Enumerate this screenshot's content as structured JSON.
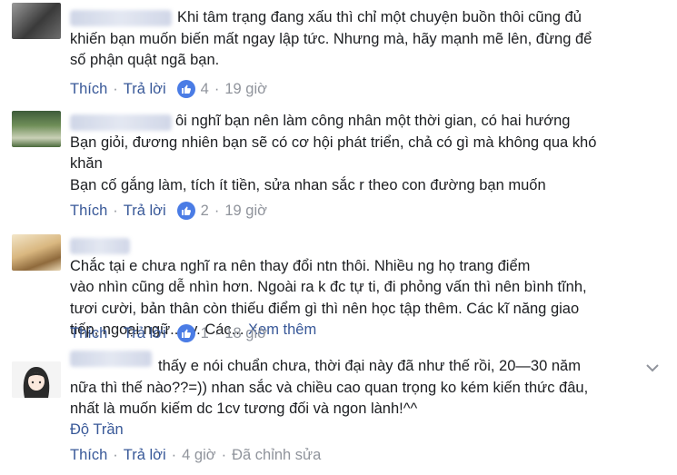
{
  "comments": [
    {
      "text": "Khi tâm trạng đang xấu thì chỉ một chuyện buồn thôi cũng đủ\nkhiến bạn muốn biến mất ngay lập tức. Nhưng mà, hãy mạnh mẽ lên, đừng để\nsố phận quật ngã bạn.",
      "like_label": "Thích",
      "reply_label": "Trả lời",
      "reactions": "4",
      "time": "19 giờ"
    },
    {
      "text": "ôi nghĩ bạn nên làm công nhân một thời gian, có hai hướng\nBạn giỏi, đương nhiên bạn sẽ có cơ hội phát triển, chả có gì mà không qua khó\nkhăn\nBạn cố gắng làm, tích ít tiền, sửa nhan sắc r theo con đường bạn muốn",
      "like_label": "Thích",
      "reply_label": "Trả lời",
      "reactions": "2",
      "time": "19 giờ"
    },
    {
      "text": "Chắc tại e chưa nghĩ ra nên thay đổi ntn thôi. Nhiều ng họ trang điểm\nvào nhìn cũng dễ nhìn hơn. Ngoài ra k đc tự ti, đi phỏng vấn thì nên bình tĩnh,\ntươi cười, bản thân còn thiếu điểm gì thì nên học tập thêm. Các kĩ năng giao\ntiếp, ngoại ngữ...vv. Các...",
      "see_more": "Xem thêm",
      "like_label": "Thích",
      "reply_label": "Trả lời",
      "reactions": "1",
      "time": "18 giờ"
    },
    {
      "text": "thấy e nói chuẩn chưa, thời đại này đã như thế rồi, 20—30 năm\nnữa thì thế nào??=)) nhan sắc và chiều cao quan trọng ko kém kiến thức đâu,\nnhất là muốn kiếm dc 1cv tương đối và ngon lành!^^",
      "tagged_name": "Độ Trần",
      "like_label": "Thích",
      "reply_label": "Trả lời",
      "time": "4 giờ",
      "edited": "Đã chỉnh sửa"
    }
  ],
  "colors": {
    "link": "#385898",
    "meta": "#90949c",
    "like_badge": "#4a7ce5"
  }
}
